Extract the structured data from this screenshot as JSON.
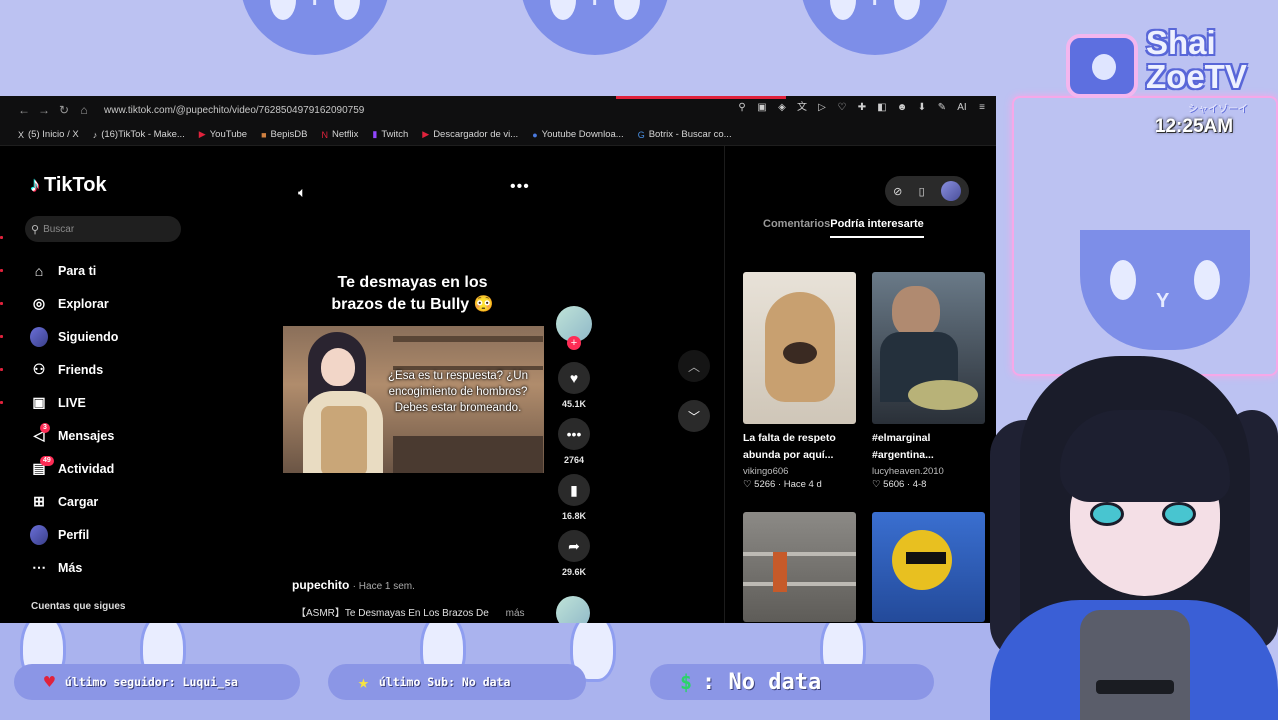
{
  "browser": {
    "url": "www.tiktok.com/@pupechito/video/7628504979162090759",
    "bookmarks": [
      {
        "icon": "x-icon",
        "glyph": "X",
        "label": "(5) Inicio / X"
      },
      {
        "icon": "tiktok-icon",
        "glyph": "♪",
        "label": "(16)TikTok - Make..."
      },
      {
        "icon": "youtube-icon",
        "glyph": "▶",
        "label": "YouTube"
      },
      {
        "icon": "bepisdb-icon",
        "glyph": "■",
        "label": "BepisDB"
      },
      {
        "icon": "netflix-icon",
        "glyph": "N",
        "label": "Netflix"
      },
      {
        "icon": "twitch-icon",
        "glyph": "▮",
        "label": "Twitch"
      },
      {
        "icon": "download-icon",
        "glyph": "▶",
        "label": "Descargador de vi..."
      },
      {
        "icon": "globe-icon",
        "glyph": "●",
        "label": "Youtube Downloa..."
      },
      {
        "icon": "google-icon",
        "glyph": "G",
        "label": "Botrix - Buscar co..."
      }
    ]
  },
  "tiktok": {
    "brand": "TikTok",
    "search_placeholder": "Buscar",
    "nav": [
      {
        "key": "for-you",
        "label": "Para ti",
        "glyph": "⌂",
        "badge": ""
      },
      {
        "key": "explore",
        "label": "Explorar",
        "glyph": "◎",
        "badge": ""
      },
      {
        "key": "following",
        "label": "Siguiendo",
        "glyph": "",
        "badge": ""
      },
      {
        "key": "friends",
        "label": "Friends",
        "glyph": "⚇",
        "badge": ""
      },
      {
        "key": "live",
        "label": "LIVE",
        "glyph": "▣",
        "badge": ""
      },
      {
        "key": "messages",
        "label": "Mensajes",
        "glyph": "◁",
        "badge": "3"
      },
      {
        "key": "activity",
        "label": "Actividad",
        "glyph": "▤",
        "badge": "49"
      },
      {
        "key": "upload",
        "label": "Cargar",
        "glyph": "⊞",
        "badge": ""
      },
      {
        "key": "profile",
        "label": "Perfil",
        "glyph": "",
        "badge": ""
      },
      {
        "key": "more",
        "label": "Más",
        "glyph": "⋯",
        "badge": ""
      }
    ],
    "following_title": "Cuentas que sigues",
    "video": {
      "title_line1": "Te desmayas en los",
      "title_line2": "brazos de tu Bully 😳",
      "subtitle": "¿Esa es tu respuesta? ¿Un encogimiento de hombros? Debes estar bromeando.",
      "likes": "45.1K",
      "comments": "2764",
      "saves": "16.8K",
      "shares": "29.6K",
      "author": "pupechito",
      "posted": "· Hace 1 sem.",
      "description": "【ASMR】Te Desmayas En Los Brazos De",
      "more_label": "más"
    },
    "side_tabs": {
      "comments": "Comentarios",
      "suggested": "Podría interesarte"
    },
    "recommended": [
      {
        "title1": "La falta de respeto",
        "title2": "abunda por aquí...",
        "author": "vikingo606",
        "stats": "♡ 5266 · Hace 4 d"
      },
      {
        "title1": "#elmarginal",
        "title2": "#argentina...",
        "author": "lucyheaven.2010",
        "stats": "♡ 5606 · 4-8"
      },
      {
        "title1": "",
        "title2": "",
        "author": "",
        "stats": ""
      },
      {
        "title1": "",
        "title2": "",
        "author": "",
        "stats": ""
      }
    ]
  },
  "overlay": {
    "logo_line1": "Shai",
    "logo_line2": "ZoeTV",
    "logo_kana": "シャイゾーイ",
    "clock": "12:25AM",
    "last_follower": "último seguidor: Luqui_sa",
    "last_sub": "último Sub: No data",
    "donation": ": No data"
  },
  "colors": {
    "tiktok_red": "#fe2c55",
    "tiktok_cyan": "#25f4ee",
    "overlay_blue": "#7d8ee8",
    "overlay_lilac": "#bcc2f2"
  }
}
